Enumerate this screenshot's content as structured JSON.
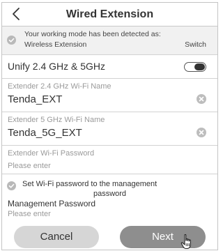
{
  "header": {
    "title": "Wired Extension",
    "back_icon": "chevron-left-icon"
  },
  "notice": {
    "line1": "Your working mode has been detected as:",
    "mode": "Wireless Extension",
    "action": "Switch"
  },
  "unify": {
    "label": "Unify 2.4 GHz & 5GHz",
    "enabled": false
  },
  "fields": {
    "ssid_24": {
      "label": "Extender 2.4 GHz Wi-Fi Name",
      "value": "Tenda_EXT"
    },
    "ssid_5": {
      "label": "Extender 5 GHz Wi-Fi Name",
      "value": "Tenda_5G_EXT"
    },
    "password": {
      "label": "Extender Wi-Fi Password",
      "placeholder": "Please enter"
    }
  },
  "management": {
    "checkbox_line1": "Set Wi-Fi password to the management",
    "checkbox_line2": "password",
    "label": "Management Password",
    "placeholder": "Please enter"
  },
  "buttons": {
    "cancel": "Cancel",
    "next": "Next"
  },
  "colors": {
    "next_button": "#8e8e8e",
    "cancel_button": "#d6d6d6",
    "notice_background": "#f1f1f1"
  }
}
